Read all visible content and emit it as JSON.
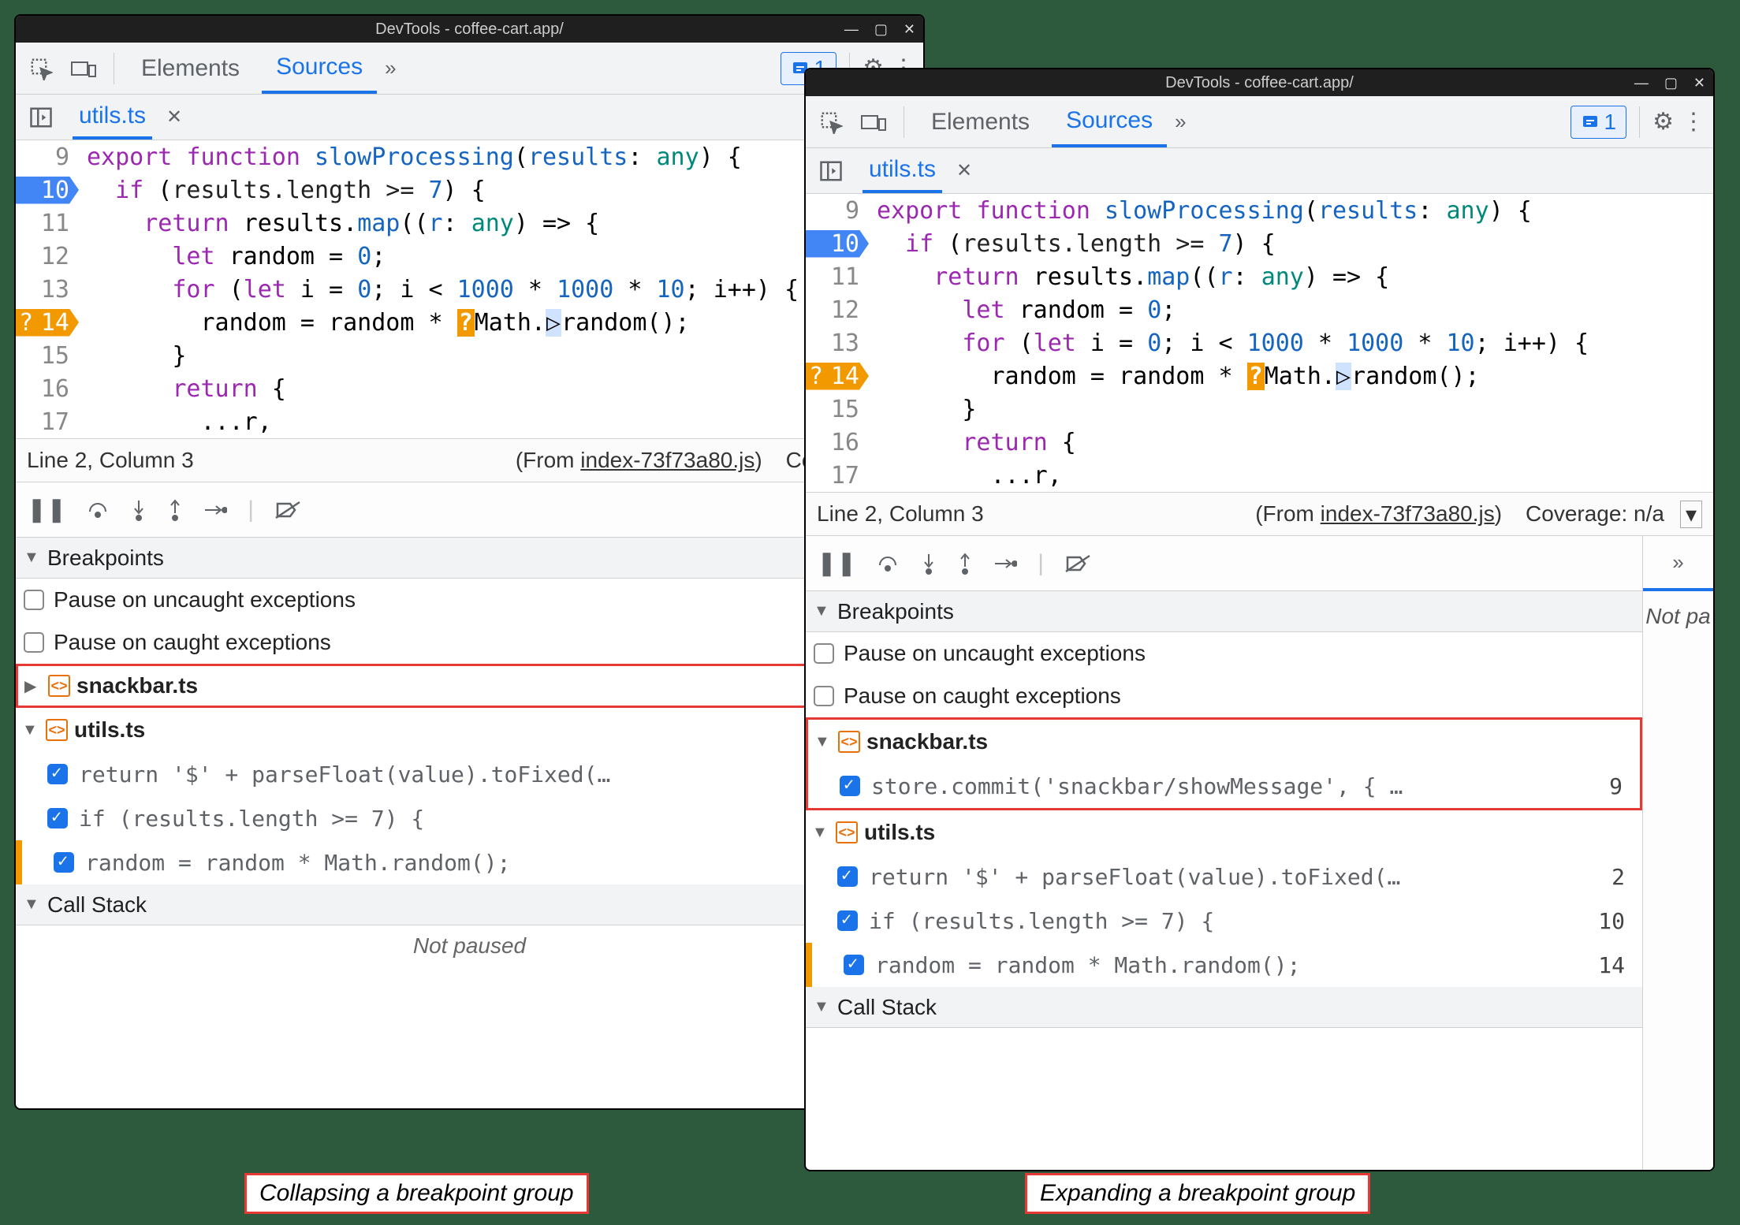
{
  "titlebar": {
    "text": "DevTools - coffee-cart.app/"
  },
  "tabs": {
    "elements": "Elements",
    "sources": "Sources"
  },
  "issues": {
    "count": "1"
  },
  "file_tab": {
    "name": "utils.ts"
  },
  "code": {
    "lines": [
      {
        "n": "9",
        "html": "<span class='k-purple'>export</span> <span class='k-purple'>function</span> <span class='k-blue'>slowProcessing</span>(<span class='k-blue'>results</span>: <span class='k-teal'>any</span>) {"
      },
      {
        "n": "10",
        "bp": "blue",
        "html": "  <span class='k-purple'>if</span> (<span class='k-black'>results.length &gt;= </span><span class='k-num'>7</span>) {"
      },
      {
        "n": "11",
        "html": "    <span class='k-purple'>return</span> results.<span class='k-blue'>map</span>((<span class='k-blue'>r</span>: <span class='k-teal'>any</span>) =&gt; {"
      },
      {
        "n": "12",
        "html": "      <span class='k-purple'>let</span> random = <span class='k-num'>0</span>;"
      },
      {
        "n": "13",
        "html": "      <span class='k-purple'>for</span> (<span class='k-purple'>let</span> i = <span class='k-num'>0</span>; i &lt; <span class='k-num'>1000</span> * <span class='k-num'>1000</span> * <span class='k-num'>10</span>; i++) {"
      },
      {
        "n": "14",
        "bp": "orange",
        "html": "        random = random * <span class='inline-orange'>?</span>Math.<span class='inline-blue'>▷</span>random();"
      },
      {
        "n": "15",
        "html": "      }"
      },
      {
        "n": "16",
        "html": "      <span class='k-purple'>return</span> {"
      },
      {
        "n": "17",
        "html": "        ...r,"
      }
    ]
  },
  "status": {
    "pos": "Line 2, Column 3",
    "from_prefix": "(From ",
    "from_file": "index-73f73a80.js",
    "from_suffix": ")",
    "coverage_left": "Coverage: n/",
    "coverage_right": "Coverage: n/a"
  },
  "breakpoints_header": "Breakpoints",
  "pause_uncaught": "Pause on uncaught exceptions",
  "pause_caught": "Pause on caught exceptions",
  "files": {
    "snackbar": "snackbar.ts",
    "utils": "utils.ts"
  },
  "snackbar_item": {
    "text": "store.commit('snackbar/showMessage', { …",
    "line": "9"
  },
  "utils_items": [
    {
      "text": "return '$' + parseFloat(value).toFixed(…",
      "line": "2"
    },
    {
      "text": "if (results.length >= 7) {",
      "line": "10"
    },
    {
      "text": "random = random * Math.random();",
      "line": "14",
      "edge": true
    }
  ],
  "callstack_header": "Call Stack",
  "not_paused": "Not paused",
  "right_side": {
    "not_pa": "Not pa"
  },
  "captions": {
    "left": "Collapsing a breakpoint group",
    "right": "Expanding a breakpoint group"
  }
}
